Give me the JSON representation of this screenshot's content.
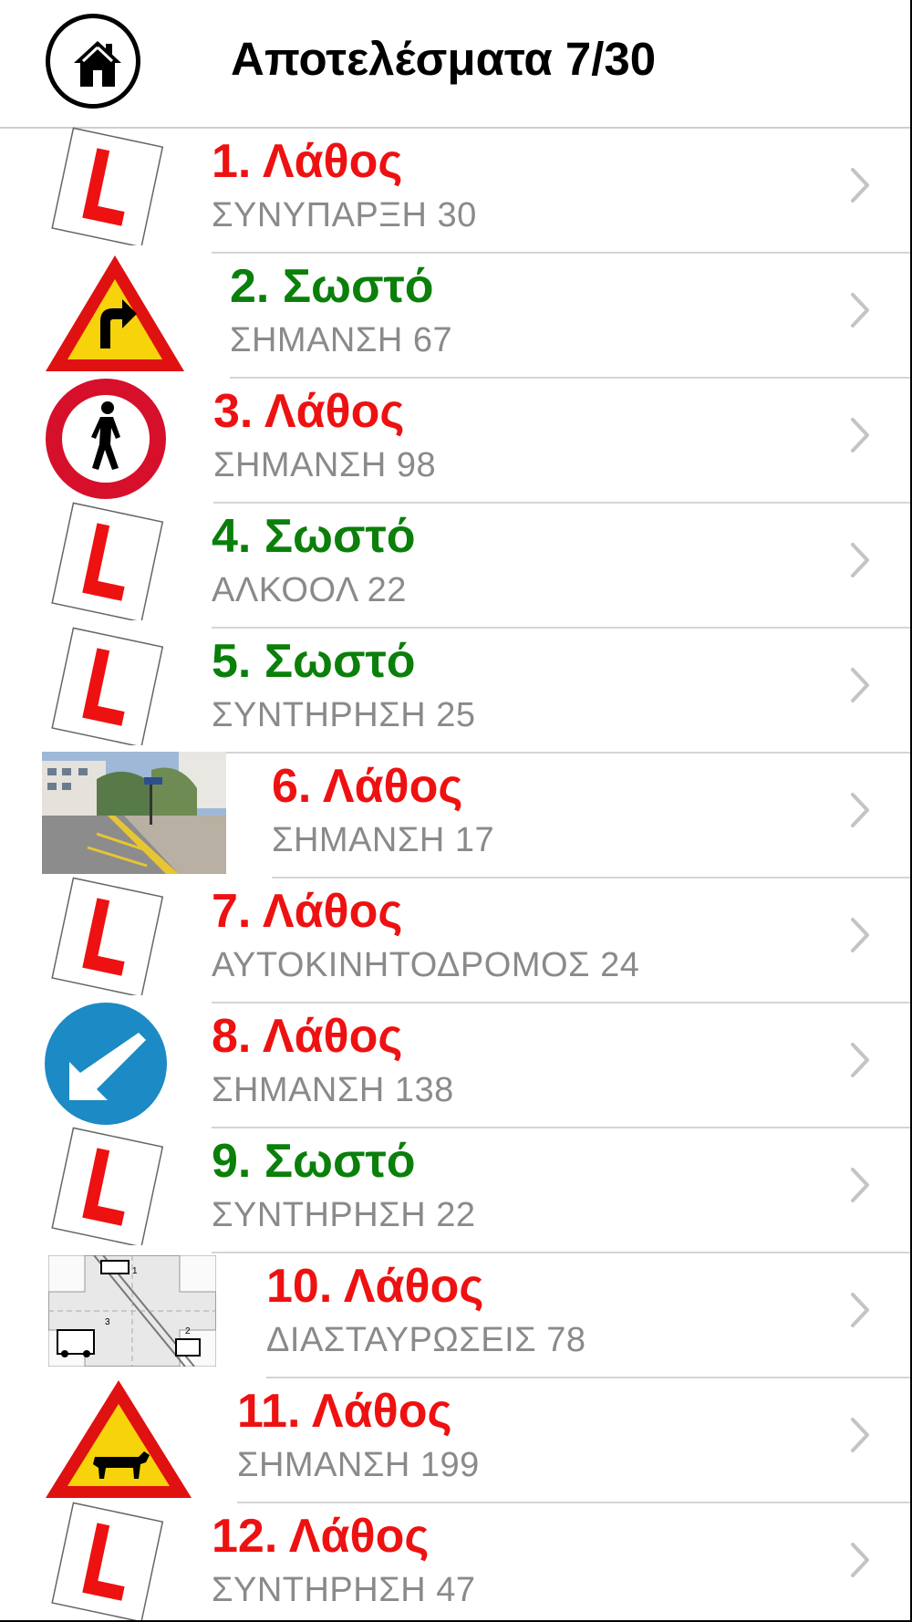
{
  "header": {
    "title": "Αποτελέσματα 7/30",
    "home_icon": "home-icon"
  },
  "colors": {
    "correct": "#0a7f0a",
    "wrong": "#ee1111",
    "subtitle": "#8a8a8a",
    "separator": "#d5d5d5"
  },
  "results": [
    {
      "title": "1. Λάθος",
      "status": "wrong",
      "category": "ΣΥΝΥΠΑΡΞΗ 30",
      "icon": "learner-l-plate-icon"
    },
    {
      "title": "2. Σωστό",
      "status": "correct",
      "category": "ΣΗΜΑΝΣΗ 67",
      "icon": "right-bend-warning-sign-icon"
    },
    {
      "title": "3. Λάθος",
      "status": "wrong",
      "category": "ΣΗΜΑΝΣΗ 98",
      "icon": "no-pedestrians-sign-icon"
    },
    {
      "title": "4. Σωστό",
      "status": "correct",
      "category": "ΑΛΚΟΟΛ 22",
      "icon": "learner-l-plate-icon"
    },
    {
      "title": "5. Σωστό",
      "status": "correct",
      "category": "ΣΥΝΤΗΡΗΣΗ 25",
      "icon": "learner-l-plate-icon"
    },
    {
      "title": "6. Λάθος",
      "status": "wrong",
      "category": "ΣΗΜΑΝΣΗ 17",
      "icon": "street-photo-icon"
    },
    {
      "title": "7. Λάθος",
      "status": "wrong",
      "category": "ΑΥΤΟΚΙΝΗΤΟΔΡΟΜΟΣ 24",
      "icon": "learner-l-plate-icon"
    },
    {
      "title": "8. Λάθος",
      "status": "wrong",
      "category": "ΣΗΜΑΝΣΗ 138",
      "icon": "keep-left-sign-icon"
    },
    {
      "title": "9. Σωστό",
      "status": "correct",
      "category": "ΣΥΝΤΗΡΗΣΗ 22",
      "icon": "learner-l-plate-icon"
    },
    {
      "title": "10. Λάθος",
      "status": "wrong",
      "category": "ΔΙΑΣΤΑΥΡΩΣΕΙΣ 78",
      "icon": "intersection-diagram-icon"
    },
    {
      "title": "11. Λάθος",
      "status": "wrong",
      "category": "ΣΗΜΑΝΣΗ 199",
      "icon": "animals-warning-sign-icon"
    },
    {
      "title": "12. Λάθος",
      "status": "wrong",
      "category": "ΣΥΝΤΗΡΗΣΗ 47",
      "icon": "learner-l-plate-icon"
    }
  ]
}
